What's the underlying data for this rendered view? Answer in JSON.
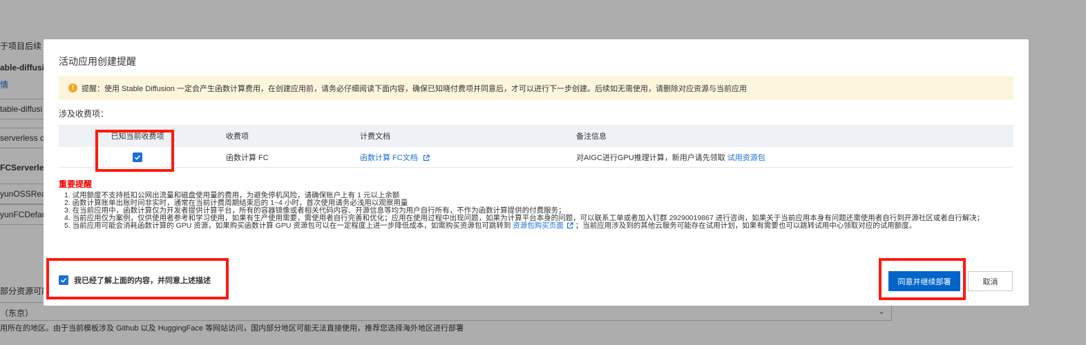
{
  "background": {
    "labels": [
      "于项目后续",
      "able-diffusion",
      "table-diffusi",
      "serverless d",
      "FCServerles",
      "yunOSSRead",
      "yunFCDefaul",
      "部分资源可能",
      "（东京）"
    ],
    "link_fragment": "情",
    "region_hint": "用所在的地区。由于当前模板涉及 Github 以及 HuggingFace 等网站访问，国内部分地区可能无法直接使用，推荐您选择海外地区进行部署"
  },
  "modal": {
    "title": "活动应用创建提醒",
    "warning": {
      "icon": "exclamation-icon",
      "text": "提醒：使用 Stable Diffusion 一定会产生函数计算费用，在创建应用前，请务必仔细阅读下面内容，确保已知晓付费项并同意后，才可以进行下一步创建。后续如无需使用，请删除对应资源与当前应用"
    },
    "fee_section_label": "涉及收费项：",
    "table": {
      "headers": [
        "已知当前收费项",
        "收费项",
        "计费文档",
        "备注信息"
      ],
      "rows": [
        {
          "acknowledged": true,
          "item": "函数计算 FC",
          "doc_link": "函数计算 FC文档",
          "note": "对AIGC进行GPU推理计算，新用户请先领取",
          "note_link": "试用资源包"
        }
      ]
    },
    "important_title": "重要提醒",
    "notes": [
      "1. 试用额度不支持抵扣公网出流量和磁盘使用量的费用，为避免停机风险，请确保账户上有 1 元以上余额",
      "2. 函数计算账单出账时间非实时，通常在当前计费周期结束后的 1~4 小时，首次使用请务必浅用以观察用量",
      "3. 在当前应用中，函数计算仅为开发者提供计算平台，所有的容器镜像或者相关代码内容、开源信息等均为用户自行所有，不作为函数计算提供的付费服务；",
      "4. 当前应用仅为案例，仅供使用者参考和学习使用，如果有生产使用需要，需使用者自行完善和优化；应用在使用过程中出现问题，如果为计算平台本身的问题，可以联系工单或者加入钉群 29290019867 进行咨询，如果关于当前应用本身有问题还需使用者自行到开源社区或者自行解决；"
    ],
    "note5": {
      "before": "5. 当前应用可能会消耗函数计算的 GPU 资源，如果购买函数计算 GPU 资源包可以在一定程度上进一步降低成本，如需购买资源包可跳转到 ",
      "link": "资源包购买页面",
      "after": "；当前应用涉及到的其他云服务可能存在试用计划，如果有需要也可以跳转试用中心领取对应的试用额度。"
    },
    "agree_checked": true,
    "agree_label": "我已经了解上面的内容，并同意上述描述",
    "confirm_label": "同意并继续部署",
    "cancel_label": "取消"
  },
  "colors": {
    "primary": "#0064c8",
    "link": "#1a6fdb",
    "warning_bg": "#fdf6dc",
    "important": "#e00000",
    "highlight_box": "#ff1a0d"
  }
}
